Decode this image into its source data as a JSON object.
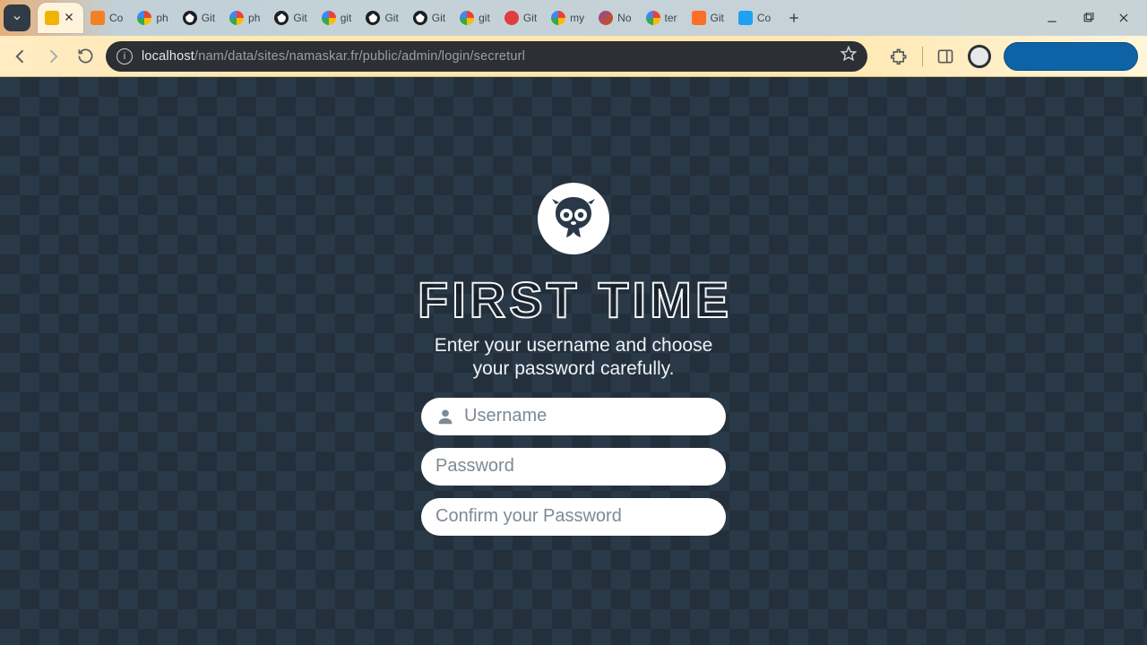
{
  "window": {
    "minimize_tip": "Minimize",
    "maximize_tip": "Maximize",
    "close_tip": "Close"
  },
  "tabs": {
    "search_tip": "Search tabs",
    "new_tab_tip": "New tab",
    "items": [
      {
        "label": "",
        "fav": "sq",
        "active": true,
        "closeable": true
      },
      {
        "label": "Co",
        "fav": "so"
      },
      {
        "label": "ph",
        "fav": "g"
      },
      {
        "label": "Git",
        "fav": "gh"
      },
      {
        "label": "ph",
        "fav": "g"
      },
      {
        "label": "Git",
        "fav": "gh"
      },
      {
        "label": "git",
        "fav": "g"
      },
      {
        "label": "Git",
        "fav": "gh"
      },
      {
        "label": "Git",
        "fav": "gh"
      },
      {
        "label": "git",
        "fav": "g"
      },
      {
        "label": "Git",
        "fav": "rd"
      },
      {
        "label": "my",
        "fav": "g"
      },
      {
        "label": "No",
        "fav": "no"
      },
      {
        "label": "ter",
        "fav": "g"
      },
      {
        "label": "Git",
        "fav": "gl"
      },
      {
        "label": "Co",
        "fav": "bl"
      }
    ]
  },
  "address": {
    "back_tip": "Back",
    "forward_tip": "Forward",
    "reload_tip": "Reload",
    "info_tip": "View site information",
    "host": "localhost",
    "path": "/nam/data/sites/namaskar.fr/public/admin/login/secreturl",
    "star_tip": "Bookmark this tab",
    "extensions_tip": "Extensions",
    "sidepanel_tip": "Side panel",
    "profile_tip": "Profile",
    "restore_label": ""
  },
  "page": {
    "title": "FIRST TIME",
    "subtitle_line1": "Enter your username and choose",
    "subtitle_line2": "your password carefully.",
    "username_placeholder": "Username",
    "password_placeholder": "Password",
    "confirm_placeholder": "Confirm your Password",
    "username_value": "",
    "password_value": "",
    "confirm_value": ""
  }
}
